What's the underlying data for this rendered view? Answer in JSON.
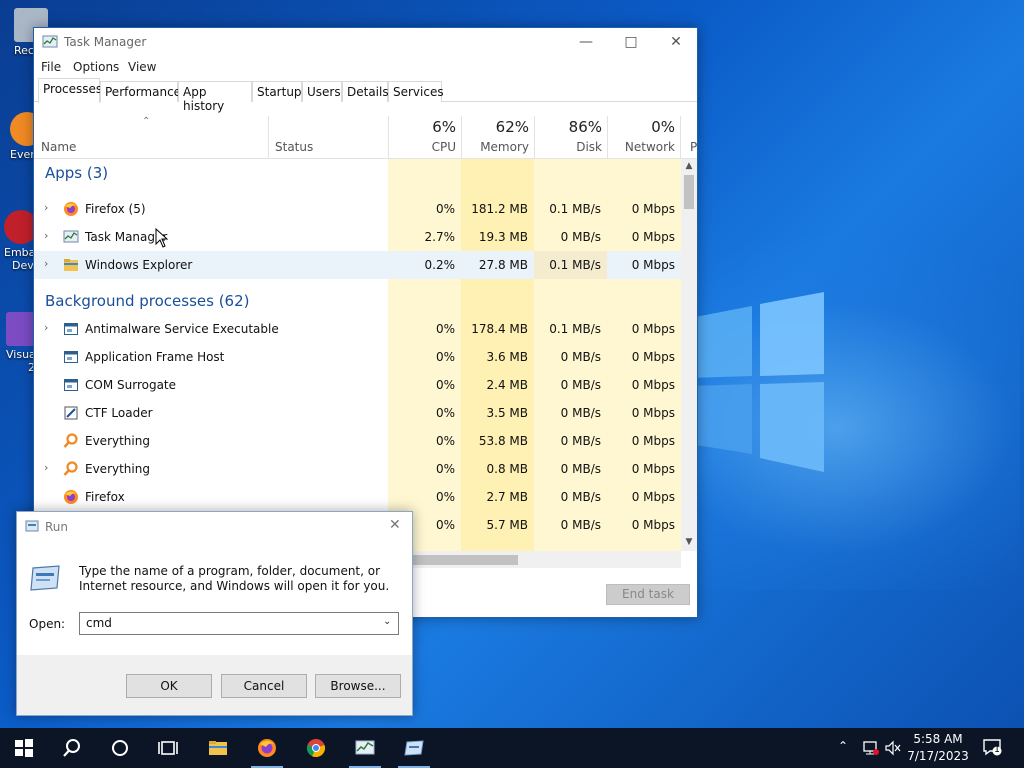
{
  "desktop": {
    "icons": [
      {
        "label": "Recy",
        "color": "#aab7c7"
      },
      {
        "label": "Ever",
        "color": "#f08a24"
      },
      {
        "label": "Emba",
        "label2": "Devi",
        "color": "#c0202a"
      },
      {
        "label": "Visua",
        "label2": "2",
        "color": "#7b4cc4"
      }
    ]
  },
  "task_manager": {
    "title": "Task Manager",
    "menu": [
      "File",
      "Options",
      "View"
    ],
    "tabs": [
      "Processes",
      "Performance",
      "App history",
      "Startup",
      "Users",
      "Details",
      "Services"
    ],
    "active_tab": "Processes",
    "columns": {
      "name": "Name",
      "status": "Status",
      "cpu": {
        "pct": "6%",
        "label": "CPU"
      },
      "memory": {
        "pct": "62%",
        "label": "Memory"
      },
      "disk": {
        "pct": "86%",
        "label": "Disk"
      },
      "network": {
        "pct": "0%",
        "label": "Network"
      },
      "power_partial": "P"
    },
    "groups": {
      "apps": "Apps (3)",
      "background": "Background processes (62)"
    },
    "apps": [
      {
        "name": "Firefox (5)",
        "icon": "firefox-icon",
        "expandable": true,
        "cpu": "0%",
        "memory": "181.2 MB",
        "disk": "0.1 MB/s",
        "network": "0 Mbps"
      },
      {
        "name": "Task Manager",
        "icon": "task-manager-icon",
        "expandable": true,
        "cpu": "2.7%",
        "memory": "19.3 MB",
        "disk": "0 MB/s",
        "network": "0 Mbps"
      },
      {
        "name": "Windows Explorer",
        "icon": "folder-icon",
        "expandable": true,
        "selected": true,
        "cpu": "0.2%",
        "memory": "27.8 MB",
        "disk": "0.1 MB/s",
        "network": "0 Mbps"
      }
    ],
    "background": [
      {
        "name": "Antimalware Service Executable",
        "icon": "app-window-icon",
        "expandable": true,
        "cpu": "0%",
        "memory": "178.4 MB",
        "disk": "0.1 MB/s",
        "network": "0 Mbps"
      },
      {
        "name": "Application Frame Host",
        "icon": "app-window-icon",
        "expandable": false,
        "cpu": "0%",
        "memory": "3.6 MB",
        "disk": "0 MB/s",
        "network": "0 Mbps"
      },
      {
        "name": "COM Surrogate",
        "icon": "app-window-icon",
        "expandable": false,
        "cpu": "0%",
        "memory": "2.4 MB",
        "disk": "0 MB/s",
        "network": "0 Mbps"
      },
      {
        "name": "CTF Loader",
        "icon": "pen-icon",
        "expandable": false,
        "cpu": "0%",
        "memory": "3.5 MB",
        "disk": "0 MB/s",
        "network": "0 Mbps"
      },
      {
        "name": "Everything",
        "icon": "magnifier-icon",
        "expandable": false,
        "cpu": "0%",
        "memory": "53.8 MB",
        "disk": "0 MB/s",
        "network": "0 Mbps"
      },
      {
        "name": "Everything",
        "icon": "magnifier-icon",
        "expandable": true,
        "cpu": "0%",
        "memory": "0.8 MB",
        "disk": "0 MB/s",
        "network": "0 Mbps"
      },
      {
        "name": "Firefox",
        "icon": "firefox-icon",
        "expandable": false,
        "cpu": "0%",
        "memory": "2.7 MB",
        "disk": "0 MB/s",
        "network": "0 Mbps"
      },
      {
        "name": "",
        "icon": "",
        "expandable": false,
        "cpu": "0%",
        "memory": "5.7 MB",
        "disk": "0 MB/s",
        "network": "0 Mbps"
      }
    ],
    "end_task": "End task"
  },
  "run_dialog": {
    "title": "Run",
    "description": "Type the name of a program, folder, document, or Internet resource, and Windows will open it for you.",
    "open_label": "Open:",
    "input_value": "cmd",
    "ok": "OK",
    "cancel": "Cancel",
    "browse": "Browse..."
  },
  "taskbar": {
    "time": "5:58 AM",
    "date": "7/17/2023",
    "notification_count": "1"
  },
  "colors": {
    "heat_light": "#fff7d1",
    "heat_medium": "#fff0b3",
    "heat_strong": "#ffe89a",
    "accent": "#1a4f9a"
  }
}
